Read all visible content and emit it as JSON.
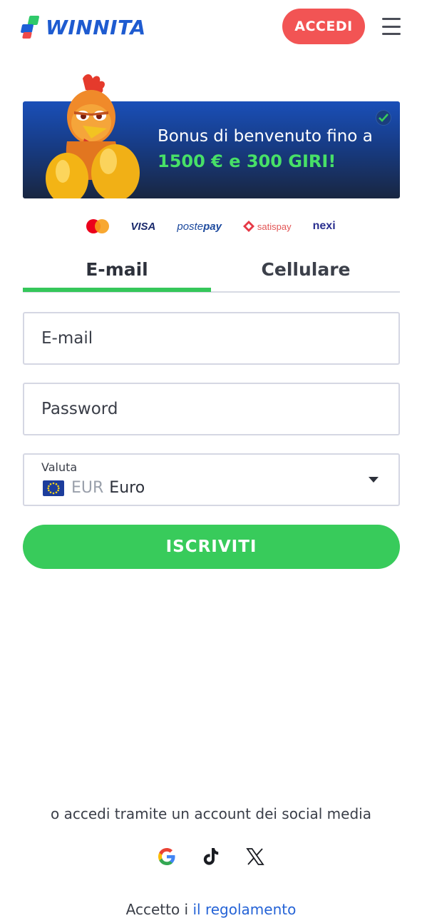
{
  "header": {
    "logo_text": "WINNITA",
    "login_label": "ACCEDI"
  },
  "banner": {
    "line1": "Bonus di benvenuto fino a",
    "line2": "1500 € e 300 GIRI!"
  },
  "payments": {
    "visa": "VISA",
    "postepay_a": "poste",
    "postepay_b": "pay",
    "satispay": "satispay",
    "nexi": "nexi"
  },
  "tabs": {
    "email": "E-mail",
    "phone": "Cellulare"
  },
  "form": {
    "email_placeholder": "E-mail",
    "password_placeholder": "Password",
    "currency_label": "Valuta",
    "currency_code": "EUR",
    "currency_name": "Euro",
    "submit_label": "ISCRIVITI"
  },
  "social": {
    "text": "o accedi tramite un account dei social media"
  },
  "terms": {
    "prefix": "Accetto i ",
    "link": "il regolamento"
  },
  "colors": {
    "accent_green": "#38cb5b",
    "login_red": "#f25454",
    "brand_blue": "#1e5bd0"
  }
}
